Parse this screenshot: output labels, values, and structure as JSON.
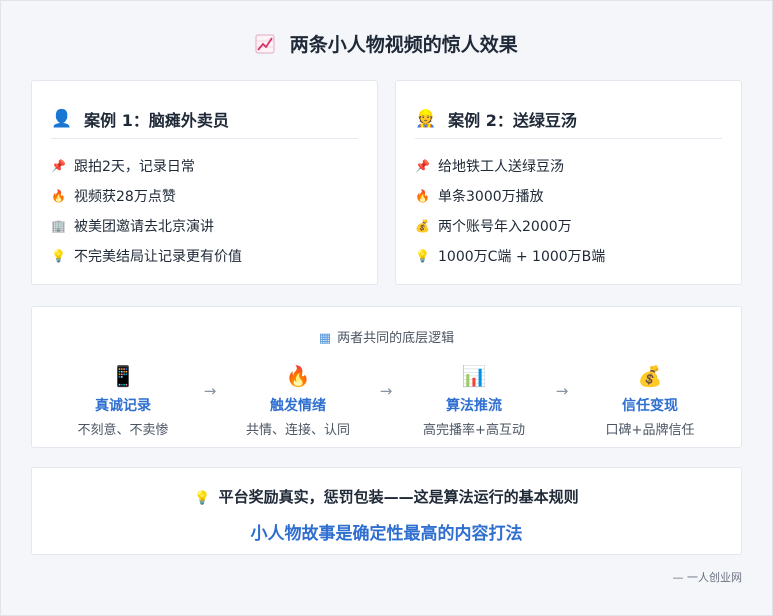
{
  "title": {
    "icon": "chart-increasing-icon",
    "text": "两条小人物视频的惊人效果"
  },
  "cases": [
    {
      "icon": "person-silhouette-icon",
      "icon_glyph": "👤",
      "heading": "案例 1：脑瘫外卖员",
      "items": [
        {
          "icon": "pushpin-icon",
          "glyph": "📌",
          "text": "跟拍2天，记录日常"
        },
        {
          "icon": "fire-icon",
          "glyph": "🔥",
          "text": "视频获28万点赞"
        },
        {
          "icon": "building-icon",
          "glyph": "🏢",
          "text": "被美团邀请去北京演讲"
        },
        {
          "icon": "lightbulb-icon",
          "glyph": "💡",
          "text": "不完美结局让记录更有价值"
        }
      ]
    },
    {
      "icon": "worker-icon",
      "icon_glyph": "👷",
      "heading": "案例 2：送绿豆汤",
      "items": [
        {
          "icon": "pushpin-icon",
          "glyph": "📌",
          "text": "给地铁工人送绿豆汤"
        },
        {
          "icon": "fire-icon",
          "glyph": "🔥",
          "text": "单条3000万播放"
        },
        {
          "icon": "money-bag-icon",
          "glyph": "💰",
          "text": "两个账号年入2000万"
        },
        {
          "icon": "lightbulb-icon",
          "glyph": "💡",
          "text": "1000万C端 + 1000万B端"
        }
      ]
    }
  ],
  "logic": {
    "icon": "calendar-icon",
    "title": "两者共同的底层逻辑",
    "steps": [
      {
        "icon": "phone-icon",
        "glyph": "📱",
        "name": "真诚记录",
        "desc": "不刻意、不卖惨"
      },
      {
        "icon": "fire-icon",
        "glyph": "🔥",
        "name": "触发情绪",
        "desc": "共情、连接、认同"
      },
      {
        "icon": "bar-chart-icon",
        "glyph": "📊",
        "name": "算法推流",
        "desc": "高完播率+高互动"
      },
      {
        "icon": "money-bag-icon",
        "glyph": "💰",
        "name": "信任变现",
        "desc": "口碑+品牌信任"
      }
    ],
    "arrow": "→"
  },
  "summary": {
    "icon": "lightbulb-icon",
    "glyph": "💡",
    "line1": "平台奖励真实，惩罚包装——这是算法运行的基本规则",
    "line2": "小人物故事是确定性最高的内容打法"
  },
  "footer": "— 一人创业网",
  "colors": {
    "accent": "#2f6fd0",
    "background": "#f4f6fa",
    "card": "#ffffff"
  }
}
